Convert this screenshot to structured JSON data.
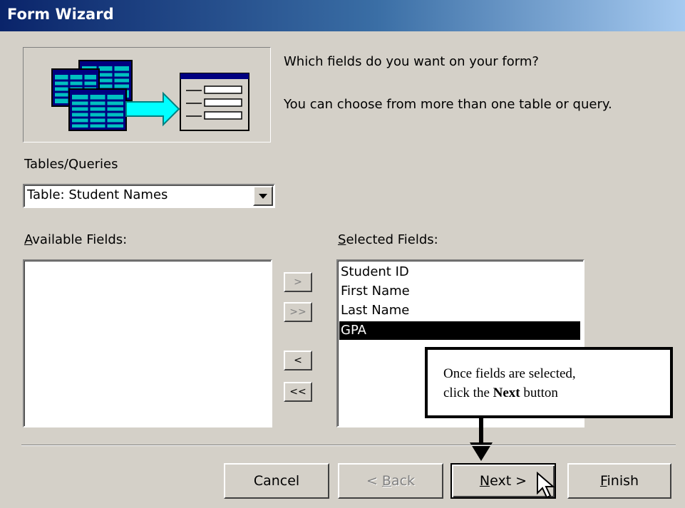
{
  "window": {
    "title": "Form Wizard"
  },
  "prompt": {
    "question": "Which fields do you want on your form?",
    "hint": "You can choose from more than one table or query."
  },
  "tables_queries": {
    "label": "Tables/Queries",
    "selected": "Table: Student Names"
  },
  "available_fields": {
    "label_access_key": "A",
    "label_rest": "vailable Fields:",
    "items": []
  },
  "selected_fields": {
    "label_access_key": "S",
    "label_rest": "elected Fields:",
    "items": [
      "Student ID",
      "First Name",
      "Last Name",
      "GPA"
    ],
    "selected_item": "GPA"
  },
  "move_buttons": {
    "add_one": ">",
    "add_all": ">>",
    "remove_one": "<",
    "remove_all": "<<"
  },
  "footer": {
    "cancel": "Cancel",
    "back_prefix": "< ",
    "back_key": "B",
    "back_rest": "ack",
    "next_key": "N",
    "next_rest": "ext >",
    "finish_key": "F",
    "finish_rest": "inish"
  },
  "callout": {
    "line1": "Once fields are selected,",
    "line2_prefix": "click the ",
    "line2_bold": "Next",
    "line2_suffix": " button"
  },
  "colors": {
    "titlebar_start": "#0a246a",
    "titlebar_end": "#a6caf0",
    "dialog_face": "#d4d0c8",
    "selection": "#000000",
    "illustration_cyan": "#00c0c0",
    "illustration_navy": "#000080"
  },
  "icons": [
    "tables-to-form-illustration-icon",
    "dropdown-arrow-icon",
    "mouse-pointer-icon",
    "callout-arrow-icon"
  ]
}
